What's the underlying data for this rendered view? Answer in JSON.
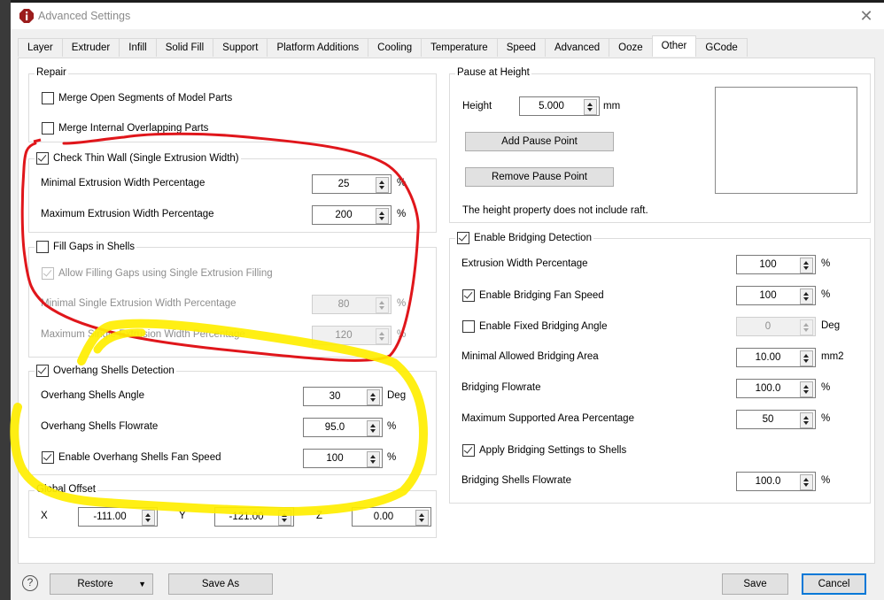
{
  "window": {
    "title": "Advanced Settings",
    "app_icon": "app-logo-icon",
    "close_icon": "close-icon"
  },
  "tabs": [
    {
      "label": "Layer",
      "active": false
    },
    {
      "label": "Extruder",
      "active": false
    },
    {
      "label": "Infill",
      "active": false
    },
    {
      "label": "Solid Fill",
      "active": false
    },
    {
      "label": "Support",
      "active": false
    },
    {
      "label": "Platform Additions",
      "active": false
    },
    {
      "label": "Cooling",
      "active": false
    },
    {
      "label": "Temperature",
      "active": false
    },
    {
      "label": "Speed",
      "active": false
    },
    {
      "label": "Advanced",
      "active": false
    },
    {
      "label": "Ooze",
      "active": false
    },
    {
      "label": "Other",
      "active": true
    },
    {
      "label": "GCode",
      "active": false
    }
  ],
  "repair": {
    "title": "Repair",
    "merge_open": {
      "label": "Merge Open Segments of Model Parts",
      "checked": false
    },
    "merge_internal": {
      "label": "Merge Internal Overlapping Parts",
      "checked": false
    }
  },
  "thin_wall": {
    "title": "Check Thin Wall (Single Extrusion Width)",
    "checked": true,
    "min_label": "Minimal Extrusion Width Percentage",
    "min_value": "25",
    "min_unit": "%",
    "max_label": "Maximum Extrusion Width Percentage",
    "max_value": "200",
    "max_unit": "%"
  },
  "fill_gaps": {
    "title": "Fill Gaps in Shells",
    "checked": false,
    "allow_label": "Allow Filling Gaps using Single Extrusion Filling",
    "allow_checked": true,
    "min_label": "Minimal Single Extrusion Width Percentage",
    "min_value": "80",
    "min_unit": "%",
    "max_label": "Maximum Single Extrusion Width Percentage",
    "max_value": "120",
    "max_unit": "%"
  },
  "overhang": {
    "title": "Overhang Shells Detection",
    "checked": true,
    "angle_label": "Overhang Shells Angle",
    "angle_value": "30",
    "angle_unit": "Deg",
    "flow_label": "Overhang Shells Flowrate",
    "flow_value": "95.0",
    "flow_unit": "%",
    "fan_label": "Enable Overhang Shells Fan Speed",
    "fan_checked": true,
    "fan_value": "100",
    "fan_unit": "%"
  },
  "global_offset": {
    "title": "Global Offset",
    "x_label": "X",
    "x_value": "-111.00",
    "y_label": "Y",
    "y_value": "-121.00",
    "z_label": "Z",
    "z_value": "0.00"
  },
  "pause": {
    "title": "Pause at Height",
    "height_label": "Height",
    "height_value": "5.000",
    "height_unit": "mm",
    "add_label": "Add Pause Point",
    "remove_label": "Remove Pause Point",
    "note": "The height property does not include raft."
  },
  "bridging": {
    "title": "Enable Bridging Detection",
    "checked": true,
    "width_label": "Extrusion Width Percentage",
    "width_value": "100",
    "width_unit": "%",
    "fan_label": "Enable Bridging Fan Speed",
    "fan_checked": true,
    "fan_value": "100",
    "fan_unit": "%",
    "angle_label": "Enable Fixed Bridging Angle",
    "angle_checked": false,
    "angle_value": "0",
    "angle_unit": "Deg",
    "area_label": "Minimal Allowed Bridging Area",
    "area_value": "10.00",
    "area_unit": "mm2",
    "flow_label": "Bridging Flowrate",
    "flow_value": "100.0",
    "flow_unit": "%",
    "support_label": "Maximum Supported Area Percentage",
    "support_value": "50",
    "support_unit": "%",
    "apply_label": "Apply Bridging Settings to Shells",
    "apply_checked": true,
    "shells_flow_label": "Bridging Shells Flowrate",
    "shells_flow_value": "100.0",
    "shells_flow_unit": "%"
  },
  "footer": {
    "help": "?",
    "restore_label": "Restore",
    "save_as_label": "Save As",
    "save_label": "Save",
    "cancel_label": "Cancel"
  },
  "annotations": {
    "red": "#e0161b",
    "yellow": "#ffee00"
  }
}
